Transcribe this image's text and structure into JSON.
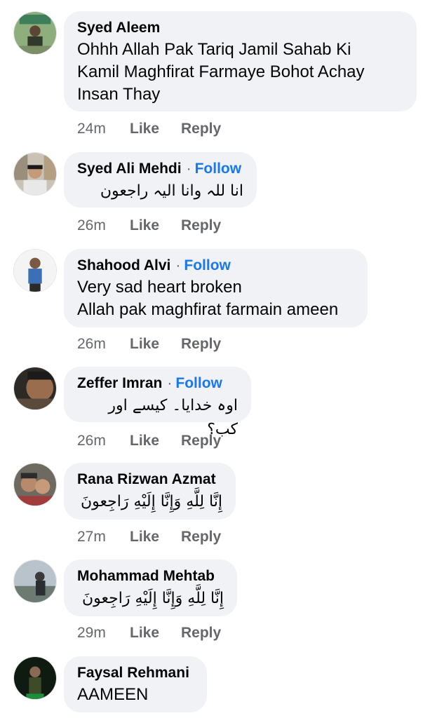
{
  "comments": [
    {
      "author": "Syed Aleem",
      "follow": "",
      "text": "Ohhh Allah Pak Tariq Jamil Sahab Ki\nKamil Maghfirat Farmaye Bohot Achay\nInsan Thay",
      "time": "24m",
      "like": "Like",
      "reply": "Reply"
    },
    {
      "author": "Syed Ali Mehdi",
      "follow": "Follow",
      "text": "انا للہ وانا الیہ راجعون",
      "time": "26m",
      "like": "Like",
      "reply": "Reply"
    },
    {
      "author": "Shahood Alvi",
      "follow": "Follow",
      "text": "Very sad heart broken\nAllah pak maghfirat farmain ameen",
      "time": "26m",
      "like": "Like",
      "reply": "Reply"
    },
    {
      "author": "Zeffer Imran",
      "follow": "Follow",
      "text": "اوہ خدایا۔ کیسے اور کب؟",
      "time": "26m",
      "like": "Like",
      "reply": "Reply"
    },
    {
      "author": "Rana Rizwan Azmat",
      "follow": "",
      "text": "إِنَّا لِلَّهِ وَإِنَّا إِلَيْهِ رَاجِعونَ",
      "time": "27m",
      "like": "Like",
      "reply": "Reply"
    },
    {
      "author": "Mohammad Mehtab",
      "follow": "",
      "text": "إِنَّا لِلَّهِ وَإِنَّا إِلَيْهِ رَاجِعونَ",
      "time": "29m",
      "like": "Like",
      "reply": "Reply"
    },
    {
      "author": "Faysal Rehmani",
      "follow": "",
      "text": "AAMEEN",
      "time": "",
      "like": "",
      "reply": ""
    }
  ],
  "separator": "·"
}
